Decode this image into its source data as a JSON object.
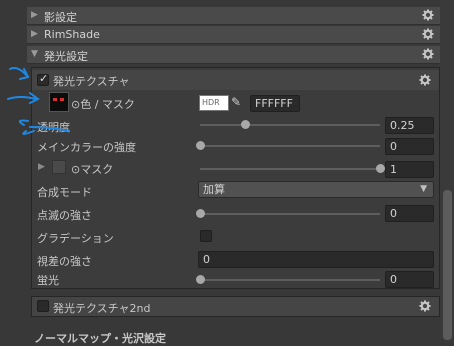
{
  "sections": {
    "shadow": {
      "label": "影設定"
    },
    "rimshade": {
      "label": "RimShade"
    },
    "emission": {
      "label": "発光設定"
    }
  },
  "emission_texture": {
    "label": "発光テクスチャ",
    "enabled": true,
    "color_mask": {
      "label": "⊙色 / マスク",
      "hdr_label": "HDR",
      "hex_value": "FFFFFF"
    },
    "transparency": {
      "label": "透明度",
      "value": "0.25",
      "fraction": 0.25
    },
    "main_color_strength": {
      "label": "メインカラーの強度",
      "value": "0",
      "fraction": 0.0
    },
    "mask": {
      "label": "⊙マスク",
      "value": "1",
      "fraction": 1.0
    },
    "blend_mode": {
      "label": "合成モード",
      "selected": "加算"
    },
    "blink_strength": {
      "label": "点滅の強さ",
      "value": "0",
      "fraction": 0.0
    },
    "gradation": {
      "label": "グラデーション",
      "checked": false
    },
    "parallax_strength": {
      "label": "視差の強さ",
      "value": "0"
    },
    "fluorescence": {
      "label": "蛍光",
      "value": "0",
      "fraction": 0.0
    }
  },
  "emission_texture_2nd": {
    "label": "発光テクスチャ2nd",
    "enabled": false
  },
  "next_section": {
    "label": "ノーマルマップ・光沢設定"
  },
  "colors": {
    "background": "#383838",
    "header": "#4a4a4a",
    "annotation": "#1e88e5"
  }
}
